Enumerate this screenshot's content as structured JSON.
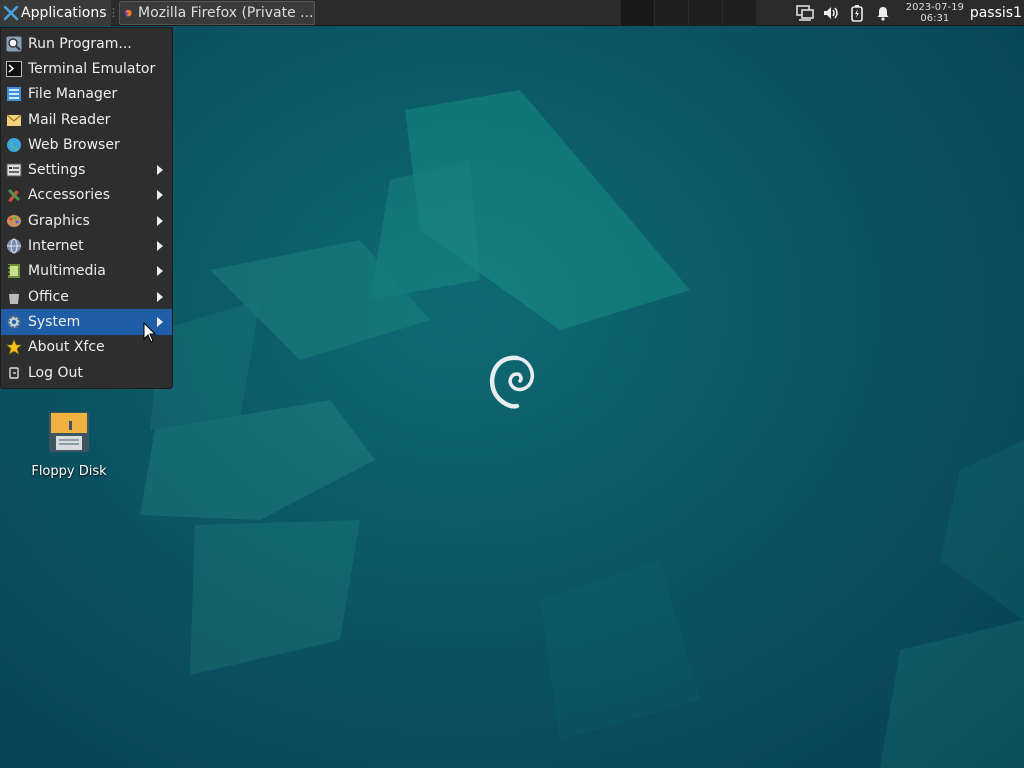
{
  "panel": {
    "applications_label": "Applications",
    "task_label": "Mozilla Firefox (Private ...",
    "date": "2023-07-19",
    "time": "06:31",
    "user": "passis1"
  },
  "menu": {
    "items": [
      {
        "label": "Run Program...",
        "icon": "search-icon",
        "submenu": false
      },
      {
        "label": "Terminal Emulator",
        "icon": "terminal-icon",
        "submenu": false
      },
      {
        "label": "File Manager",
        "icon": "file-manager-icon",
        "submenu": false
      },
      {
        "label": "Mail Reader",
        "icon": "mail-icon",
        "submenu": false
      },
      {
        "label": "Web Browser",
        "icon": "globe-icon",
        "submenu": false
      },
      {
        "label": "Settings",
        "icon": "settings-icon",
        "submenu": true
      },
      {
        "label": "Accessories",
        "icon": "accessories-icon",
        "submenu": true
      },
      {
        "label": "Graphics",
        "icon": "graphics-icon",
        "submenu": true
      },
      {
        "label": "Internet",
        "icon": "internet-icon",
        "submenu": true
      },
      {
        "label": "Multimedia",
        "icon": "multimedia-icon",
        "submenu": true
      },
      {
        "label": "Office",
        "icon": "office-icon",
        "submenu": true
      },
      {
        "label": "System",
        "icon": "gear-icon",
        "submenu": true,
        "selected": true
      },
      {
        "label": "About Xfce",
        "icon": "star-icon",
        "submenu": false
      },
      {
        "label": "Log Out",
        "icon": "logout-icon",
        "submenu": false
      }
    ]
  },
  "desktop": {
    "icons": [
      {
        "label": "Floppy Disk",
        "icon": "floppy-disk-icon"
      }
    ]
  },
  "colors": {
    "panel": "#2b2b2b",
    "menu": "#2e2e2e",
    "selection": "#1f5ea6",
    "wallpaper": "#0b5a67"
  }
}
